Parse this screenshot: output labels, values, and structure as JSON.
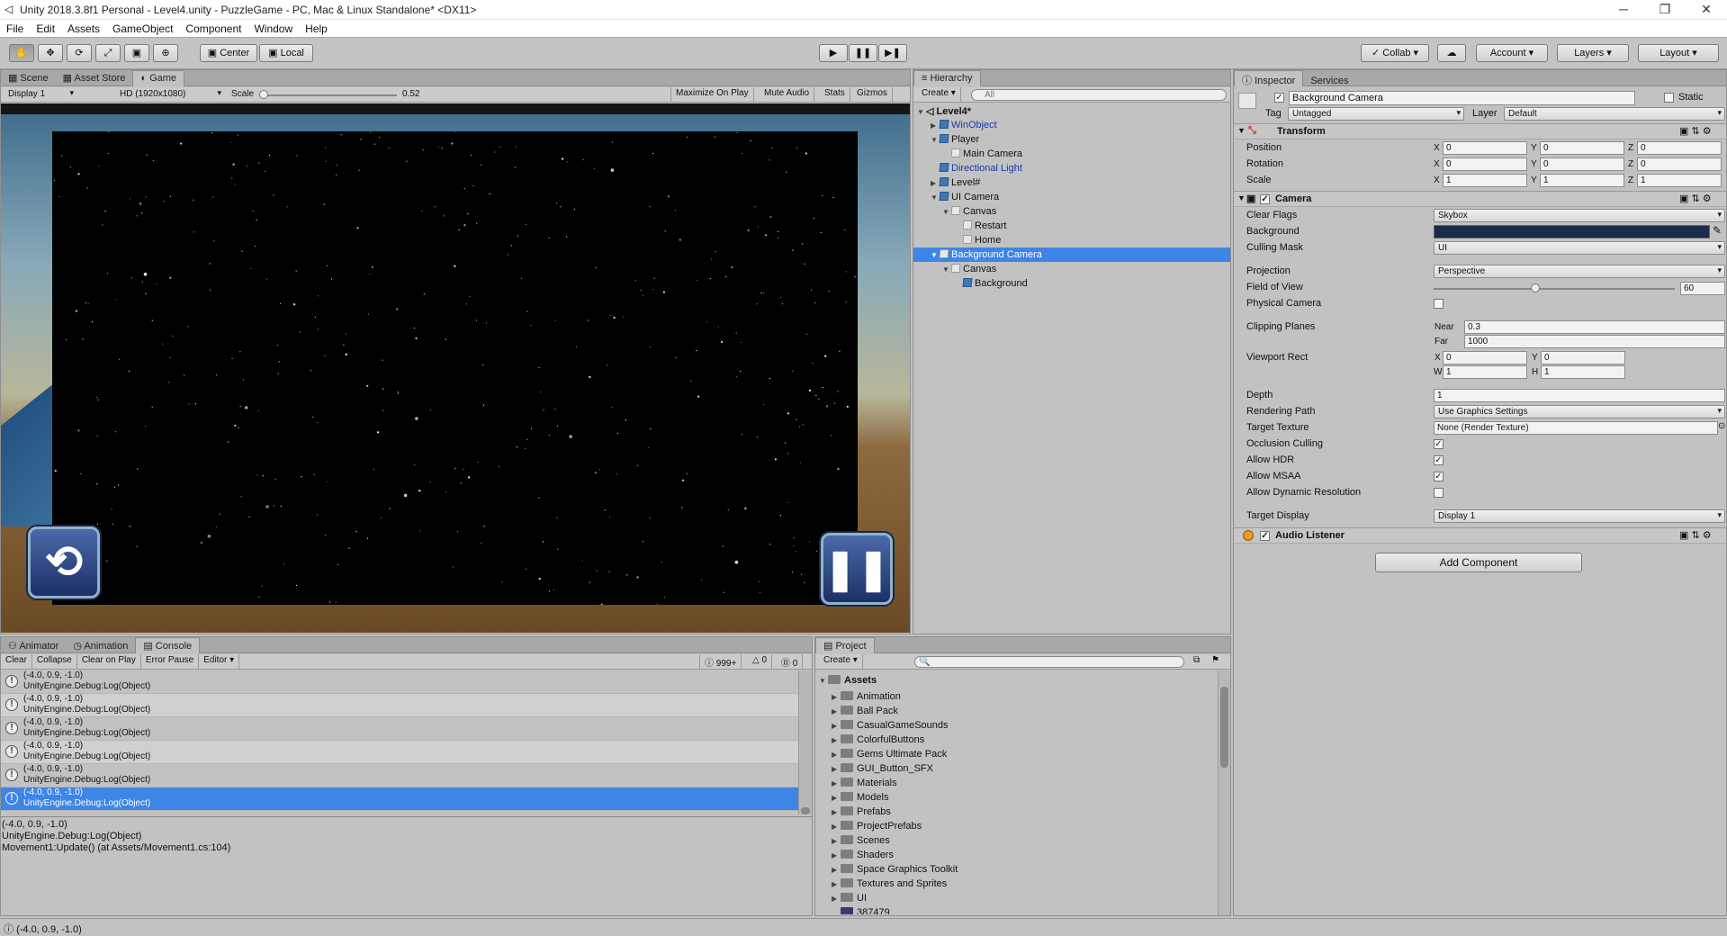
{
  "window": {
    "title": "Unity 2018.3.8f1 Personal - Level4.unity - PuzzleGame - PC, Mac & Linux Standalone* <DX11>",
    "minimize": "─",
    "maximize": "❐",
    "close": "✕"
  },
  "menu": [
    "File",
    "Edit",
    "Assets",
    "GameObject",
    "Component",
    "Window",
    "Help"
  ],
  "toolbar": {
    "pivot": "Center",
    "space": "Local",
    "collab": "Collab",
    "account": "Account",
    "layers": "Layers",
    "layout": "Layout"
  },
  "game": {
    "tabs": [
      "Scene",
      "Asset Store",
      "Game"
    ],
    "display": "Display 1",
    "resolution": "HD (1920x1080)",
    "scale_label": "Scale",
    "scale_value": "0.52",
    "scale_level": 0.0,
    "buttons": [
      "Maximize On Play",
      "Mute Audio",
      "Stats",
      "Gizmos"
    ]
  },
  "hierarchy": {
    "tab": "Hierarchy",
    "create": "Create",
    "search_placeholder": "All",
    "scene": "Level4*",
    "items": [
      {
        "label": "WinObject",
        "blue": true,
        "arrow": "▶",
        "icon": "cube-icon"
      },
      {
        "label": "Player",
        "blue": false,
        "arrow": "▼",
        "icon": "cube-icon"
      },
      {
        "label": "Main Camera",
        "blue": false,
        "arrow": "",
        "icon": "white-cube-icon"
      },
      {
        "label": "Directional Light",
        "blue": true,
        "arrow": "",
        "icon": "cube-icon"
      },
      {
        "label": "Level#",
        "blue": false,
        "arrow": "▶",
        "icon": "cube-icon"
      },
      {
        "label": "UI Camera",
        "blue": false,
        "arrow": "▼",
        "icon": "cube-icon"
      },
      {
        "label": "Canvas",
        "blue": false,
        "arrow": "▼",
        "icon": "white-cube-icon"
      },
      {
        "label": "Restart",
        "blue": false,
        "arrow": "",
        "icon": "white-cube-icon"
      },
      {
        "label": "Home",
        "blue": false,
        "arrow": "",
        "icon": "white-cube-icon"
      },
      {
        "label": "Background Camera",
        "blue": false,
        "arrow": "▼",
        "icon": "white-cube-icon",
        "selected": true
      },
      {
        "label": "Canvas",
        "blue": false,
        "arrow": "▼",
        "icon": "white-cube-icon"
      },
      {
        "label": "Background",
        "blue": false,
        "arrow": "",
        "icon": "cube-icon"
      }
    ]
  },
  "inspector": {
    "tabs": [
      "Inspector",
      "Services"
    ],
    "object_name": "Background Camera",
    "static_label": "Static",
    "tag_label": "Tag",
    "tag_value": "Untagged",
    "layer_label": "Layer",
    "layer_value": "Default",
    "transform": {
      "title": "Transform",
      "rows": [
        {
          "label": "Position",
          "x": "0",
          "y": "0",
          "z": "0"
        },
        {
          "label": "Rotation",
          "x": "0",
          "y": "0",
          "z": "0"
        },
        {
          "label": "Scale",
          "x": "1",
          "y": "1",
          "z": "1"
        }
      ]
    },
    "camera": {
      "title": "Camera",
      "clear_flags_label": "Clear Flags",
      "clear_flags": "Skybox",
      "background_label": "Background",
      "culling_mask_label": "Culling Mask",
      "culling_mask": "UI",
      "projection_label": "Projection",
      "projection": "Perspective",
      "fov_label": "Field of View",
      "fov": "60",
      "fov_level": 0.42,
      "physical_label": "Physical Camera",
      "clipping_label": "Clipping Planes",
      "near_label": "Near",
      "near": "0.3",
      "far_label": "Far",
      "far": "1000",
      "viewport_label": "Viewport Rect",
      "vx": "0",
      "vy": "0",
      "vw": "1",
      "vh": "1",
      "depth_label": "Depth",
      "depth": "1",
      "rendering_label": "Rendering Path",
      "rendering": "Use Graphics Settings",
      "target_texture_label": "Target Texture",
      "target_texture": "None (Render Texture)",
      "occlusion_label": "Occlusion Culling",
      "hdr_label": "Allow HDR",
      "msaa_label": "Allow MSAA",
      "dynres_label": "Allow Dynamic Resolution",
      "target_display_label": "Target Display",
      "target_display": "Display 1"
    },
    "audio": {
      "title": "Audio Listener"
    },
    "add_component": "Add Component"
  },
  "console": {
    "tabs": [
      "Animator",
      "Animation",
      "Console"
    ],
    "buttons": [
      "Clear",
      "Collapse",
      "Clear on Play",
      "Error Pause",
      "Editor"
    ],
    "count_warn": "999+",
    "count_info": "0",
    "count_err": "0",
    "rows": [
      {
        "l1": "(-4.0, 0.9, -1.0)",
        "l2": "UnityEngine.Debug:Log(Object)"
      },
      {
        "l1": "(-4.0, 0.9, -1.0)",
        "l2": "UnityEngine.Debug:Log(Object)"
      },
      {
        "l1": "(-4.0, 0.9, -1.0)",
        "l2": "UnityEngine.Debug:Log(Object)"
      },
      {
        "l1": "(-4.0, 0.9, -1.0)",
        "l2": "UnityEngine.Debug:Log(Object)"
      },
      {
        "l1": "(-4.0, 0.9, -1.0)",
        "l2": "UnityEngine.Debug:Log(Object)"
      },
      {
        "l1": "(-4.0, 0.9, -1.0)",
        "l2": "UnityEngine.Debug:Log(Object)"
      }
    ],
    "detail": [
      "(-4.0, 0.9, -1.0)",
      "UnityEngine.Debug:Log(Object)",
      "Movement1:Update() (at Assets/Movement1.cs:104)"
    ]
  },
  "project": {
    "tab": "Project",
    "create": "Create",
    "root": "Assets",
    "folders": [
      "Animation",
      "Ball Pack",
      "CasualGameSounds",
      "ColorfulButtons",
      "Gems Ultimate Pack",
      "GUI_Button_SFX",
      "Materials",
      "Models",
      "Prefabs",
      "ProjectPrefabs",
      "Scenes",
      "Shaders",
      "Space Graphics Toolkit",
      "Textures and Sprites",
      "UI",
      "387479"
    ]
  },
  "statusbar": {
    "text": "(-4.0, 0.9, -1.0)"
  },
  "colors": {
    "selection": "#3d85e6",
    "camera_bg": "#1b2b4a",
    "prefab_blue": "#1a3aa8"
  }
}
